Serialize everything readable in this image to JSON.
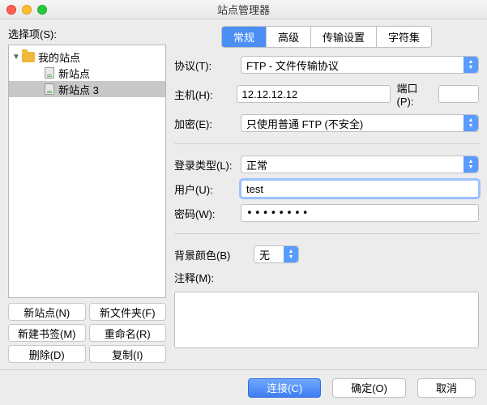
{
  "window": {
    "title": "站点管理器"
  },
  "left": {
    "label": "选择项(S):",
    "tree": {
      "root": "我的站点",
      "items": [
        "新站点",
        "新站点 3"
      ],
      "selected_index": 1
    },
    "buttons": {
      "new_site": "新站点(N)",
      "new_folder": "新文件夹(F)",
      "new_bookmark": "新建书签(M)",
      "rename": "重命名(R)",
      "delete": "删除(D)",
      "copy": "复制(I)"
    }
  },
  "tabs": {
    "items": [
      "常规",
      "高级",
      "传输设置",
      "字符集"
    ],
    "active_index": 0
  },
  "form": {
    "protocol_label": "协议(T):",
    "protocol_value": "FTP - 文件传输协议",
    "host_label": "主机(H):",
    "host_value": "12.12.12.12",
    "port_label": "端口(P):",
    "port_value": "",
    "encryption_label": "加密(E):",
    "encryption_value": "只使用普通 FTP (不安全)",
    "logon_type_label": "登录类型(L):",
    "logon_type_value": "正常",
    "user_label": "用户(U):",
    "user_value": "test",
    "password_label": "密码(W):",
    "password_value": "••••••••",
    "bgcolor_label": "背景颜色(B)",
    "bgcolor_value": "无",
    "comment_label": "注释(M):"
  },
  "footer": {
    "connect": "连接(C)",
    "ok": "确定(O)",
    "cancel": "取消"
  }
}
